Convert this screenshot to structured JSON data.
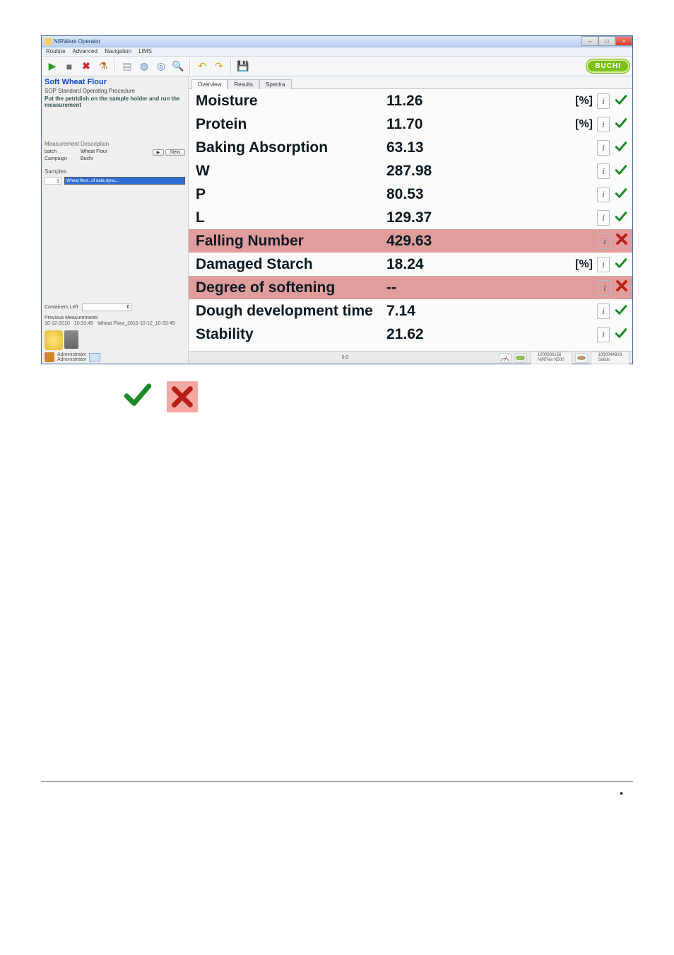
{
  "window": {
    "title": "NIRWare Operator",
    "menus": [
      "Routine",
      "Advanced",
      "Navigation",
      "LIMS"
    ]
  },
  "brand": {
    "label": "BUCHI"
  },
  "sidebar": {
    "title": "Soft Wheat Flour",
    "sop_head": "SOP Standard Operating Procedure",
    "sop_desc": "Put the petridish on the sample holder and run the measurement",
    "meas_desc_head": "Measurement Description",
    "batch_label": "batch",
    "batch_value": "Wheat Flour",
    "campaign_label": "Campaign",
    "campaign_value": "Buchi",
    "run_btn": "▶",
    "new_btn": "New",
    "samples_head": "Samples",
    "sample_idx": "1",
    "sample_sel": "Wheat flour...of data dyna...",
    "containers_label": "Containers Left",
    "containers_value": "0",
    "prev_head": "Previous Measurements",
    "prev_date": "10-12-2010",
    "prev_time": "10:33:45",
    "prev_name": "Wheat Flour_2010-10-12_10-33-45",
    "admin1": "Administrator",
    "admin2": "Administrator"
  },
  "tabs": {
    "overview": "Overview",
    "results": "Results",
    "spectra": "Spectra"
  },
  "results": [
    {
      "name": "Moisture",
      "value": "11.26",
      "unit": "[%]",
      "status": "ok",
      "red": false
    },
    {
      "name": "Protein",
      "value": "11.70",
      "unit": "[%]",
      "status": "ok",
      "red": false
    },
    {
      "name": "Baking Absorption",
      "value": "63.13",
      "unit": "",
      "status": "ok",
      "red": false
    },
    {
      "name": "W",
      "value": "287.98",
      "unit": "",
      "status": "ok",
      "red": false
    },
    {
      "name": "P",
      "value": "80.53",
      "unit": "",
      "status": "ok",
      "red": false
    },
    {
      "name": "L",
      "value": "129.37",
      "unit": "",
      "status": "ok",
      "red": false
    },
    {
      "name": "Falling Number",
      "value": "429.63",
      "unit": "",
      "status": "bad",
      "red": true
    },
    {
      "name": "Damaged Starch",
      "value": "18.24",
      "unit": "[%]",
      "status": "ok",
      "red": false
    },
    {
      "name": "Degree of softening",
      "value": "--",
      "unit": "",
      "status": "bad",
      "red": true
    },
    {
      "name": "Dough development time",
      "value": "7.14",
      "unit": "",
      "status": "ok",
      "red": false
    },
    {
      "name": "Stability",
      "value": "21.62",
      "unit": "",
      "status": "ok",
      "red": false
    }
  ],
  "statusbar": {
    "mid": "0.0",
    "chip1_top": "1000000156",
    "chip1_bot": "NIRFlex N500",
    "chip2_top": "1000044819",
    "chip2_bot": "Solids"
  },
  "bullet": "•"
}
